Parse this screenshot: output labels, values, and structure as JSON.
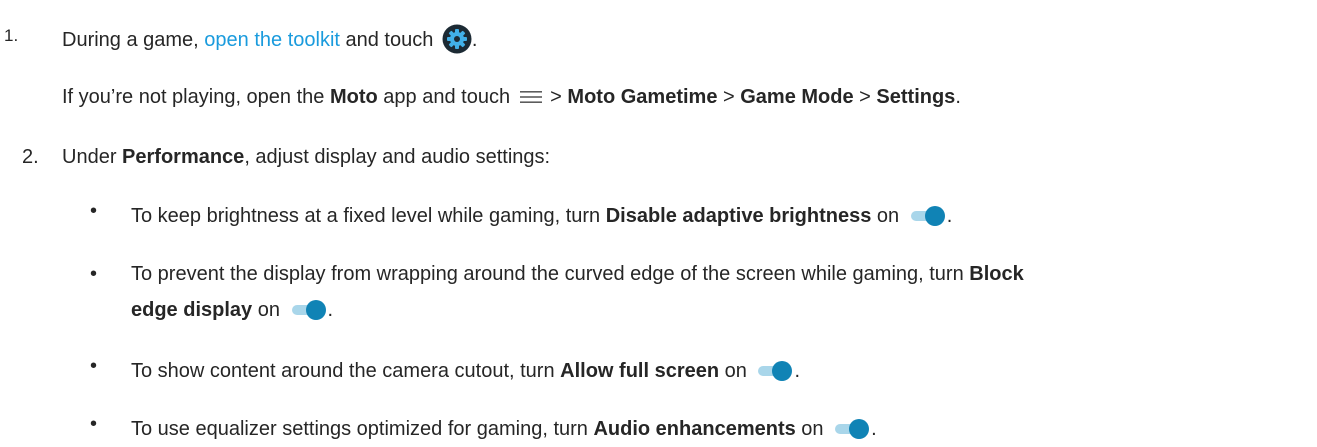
{
  "step1": {
    "number": "1.",
    "text_before": "During a game, ",
    "link": "open the toolkit",
    "text_after": " and touch ",
    "end": ".",
    "gear_icon": "settings-gear-icon",
    "gear_color": "#1c2a34"
  },
  "step1_alt": {
    "t1": "If you’re not playing, open the ",
    "b1": "Moto",
    "t2": " app and touch ",
    "menu_icon": "hamburger-menu-icon",
    "t3": " > ",
    "b2": "Moto Gametime",
    "t4": " > ",
    "b3": "Game Mode",
    "t5": " > ",
    "b4": "Settings",
    "t6": "."
  },
  "step2": {
    "number": "2.",
    "t1": "Under ",
    "b1": "Performance",
    "t2": ", adjust display and audio settings:"
  },
  "bullets": [
    {
      "t1": "To keep brightness at a fixed level while gaming, turn ",
      "b1": "Disable adaptive brightness",
      "t2": " on ",
      "end": "."
    },
    {
      "line1_t1": "To prevent the display from wrapping around the curved edge of the screen while gaming, turn ",
      "line1_b1": "Block",
      "line2_b1": "edge display",
      "line2_t1": " on ",
      "end": "."
    },
    {
      "t1": "To show content around the camera cutout, turn ",
      "b1": "Allow full screen",
      "t2": " on ",
      "end": "."
    },
    {
      "t1": "To use equalizer settings optimized for gaming, turn ",
      "b1": "Audio enhancements",
      "t2": " on ",
      "end": "."
    }
  ],
  "bullet_char": "•",
  "colors": {
    "text": "#262626",
    "link": "#1a9bdd",
    "toggle_track": "#a9d6ea",
    "toggle_thumb": "#1083b5"
  },
  "toggle_icon": "toggle-on-icon"
}
